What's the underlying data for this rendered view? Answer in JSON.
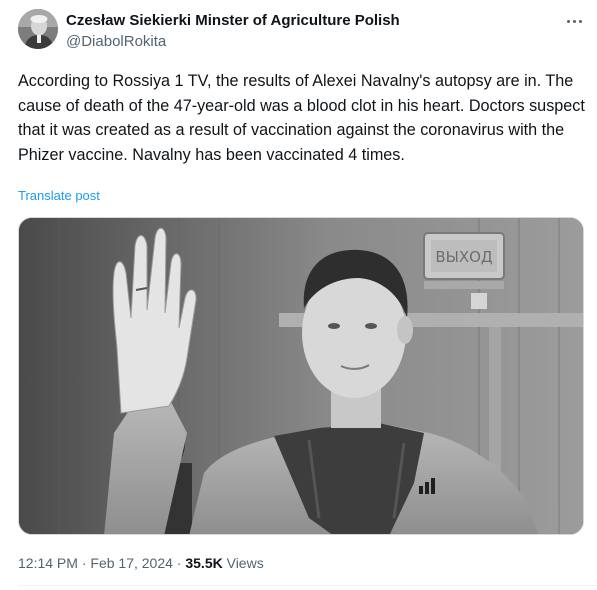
{
  "author": {
    "name": "Czesław Siekierki Minster of Agriculture Polish",
    "handle": "@DiabolRokita"
  },
  "post": {
    "text": "According to Rossiya 1 TV, the results of Alexei Navalny's autopsy are in. The cause of death of the 47-year-old was a blood clot in his heart. Doctors suspect that it was created as a result of vaccination against the coronavirus with the Phizer vaccine. Navalny has been vaccinated 4 times.",
    "translate_label": "Translate post",
    "media": {
      "kind": "black-and-white photo",
      "sign_text": "ВЫХОД"
    }
  },
  "meta": {
    "time": "12:14 PM",
    "dot1": "·",
    "date": "Feb 17, 2024",
    "dot2": "·",
    "views_count": "35.5K",
    "views_label": "Views"
  },
  "icons": {
    "more": "more-options-icon"
  },
  "colors": {
    "link": "#1d9bf0",
    "secondary_text": "#536471",
    "primary_text": "#0f1419"
  }
}
